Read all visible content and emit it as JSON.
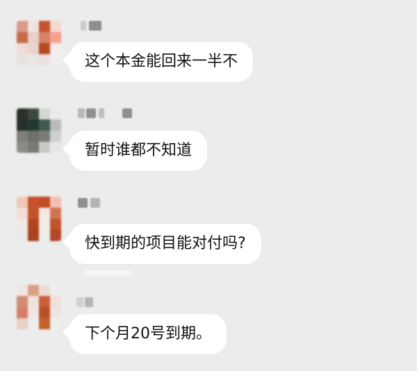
{
  "messages": [
    {
      "text": "这个本金能回来一半不"
    },
    {
      "text": "暂时谁都不知道"
    },
    {
      "text": "快到期的项目能对付吗?"
    },
    {
      "text": "下个月20号到期。"
    }
  ]
}
